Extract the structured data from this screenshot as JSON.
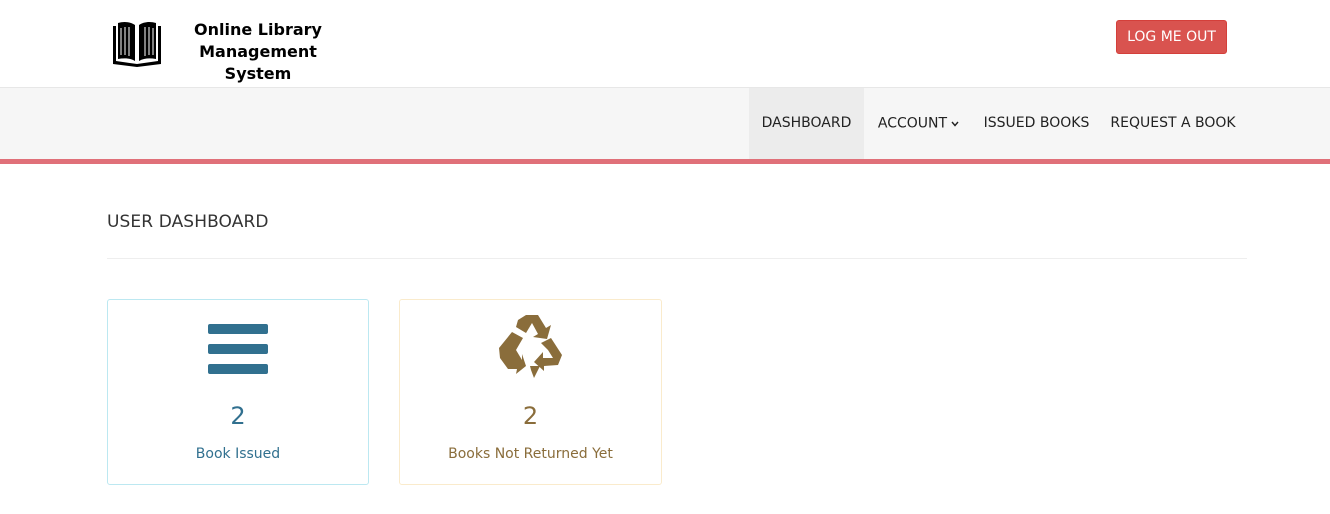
{
  "header": {
    "brand_line1": "Online Library",
    "brand_line2": "Management System",
    "logo_icon": "open-book-icon",
    "logout_label": "LOG ME OUT"
  },
  "nav": {
    "items": [
      {
        "label": "DASHBOARD",
        "active": true
      },
      {
        "label": "ACCOUNT",
        "has_dropdown": true
      },
      {
        "label": "ISSUED BOOKS"
      },
      {
        "label": "REQUEST A BOOK"
      }
    ],
    "accent_color": "#e07079"
  },
  "main": {
    "title": "USER DASHBOARD",
    "cards": [
      {
        "icon": "bars-icon",
        "count": "2",
        "label": "Book Issued",
        "color": "#31708f"
      },
      {
        "icon": "recycle-icon",
        "count": "2",
        "label": "Books Not Returned Yet",
        "color": "#8a6d3b"
      }
    ]
  }
}
